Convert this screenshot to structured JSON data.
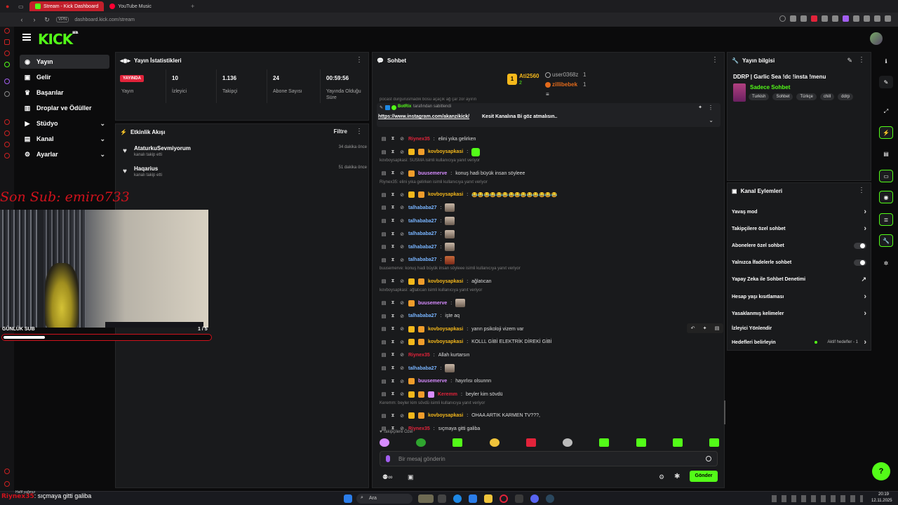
{
  "browser": {
    "tabs": [
      {
        "label": "Stream - Kick Dashboard",
        "active": true,
        "color": "#53fc18"
      },
      {
        "label": "YouTube Music",
        "active": false,
        "color": "#ff0033"
      }
    ],
    "vpn_label": "VPN",
    "url": "dashboard.kick.com/stream"
  },
  "header": {
    "logo": "KICK",
    "logo_sup": "BETA"
  },
  "sidebar": {
    "items": [
      {
        "label": "Yayın",
        "icon": "broadcast-icon",
        "active": true,
        "expandable": false
      },
      {
        "label": "Gelir",
        "icon": "wallet-icon",
        "active": false,
        "expandable": false
      },
      {
        "label": "Başarılar",
        "icon": "trophy-icon",
        "active": false,
        "expandable": false
      },
      {
        "label": "Droplar ve Ödüller",
        "icon": "gift-icon",
        "active": false,
        "expandable": false
      },
      {
        "label": "Stüdyo",
        "icon": "studio-icon",
        "active": false,
        "expandable": true
      },
      {
        "label": "Kanal",
        "icon": "channel-icon",
        "active": false,
        "expandable": true
      },
      {
        "label": "Ayarlar",
        "icon": "gear-icon",
        "active": false,
        "expandable": true
      }
    ]
  },
  "stats": {
    "title": "Yayın İstatistikleri",
    "live_badge": "YAYINDA",
    "items": [
      {
        "value": "",
        "label": "Yayın"
      },
      {
        "value": "10",
        "label": "İzleyici"
      },
      {
        "value": "1.136",
        "label": "Takipçi"
      },
      {
        "value": "24",
        "label": "Abone Sayısı"
      },
      {
        "value": "00:59:56",
        "label": "Yayında Olduğu Süre"
      }
    ]
  },
  "activity": {
    "title": "Etkinlik Akışı",
    "filter": "Filtre",
    "items": [
      {
        "name": "AtaturkuSevmiyorum",
        "sub": "kanalı takip etti",
        "time": "34 dakika önce"
      },
      {
        "name": "Haqarius",
        "sub": "kanalı takip etti",
        "time": "51 dakika önce"
      }
    ]
  },
  "overlay": {
    "last_sub": "Son Sub: emiro733",
    "daily_sub_label": "GÜNLÜK SUB",
    "daily_sub_count": "1 / 5",
    "daily_sub_progress": 0.2
  },
  "chat": {
    "title": "Sohbet",
    "top_gifters": [
      {
        "name": "Ati2560",
        "count": "2",
        "color": "#f5b81b"
      },
      {
        "name": "user0368z",
        "count": "1",
        "color": "#aaaaaa"
      },
      {
        "name": "zillibebek",
        "count": "1",
        "color": "#e36a1b"
      }
    ],
    "cut_text": "pocast durgurusmadık bosu açaçık ağ çar zor ayırın",
    "pinned": {
      "by_name": "BotRix",
      "by_suffix": "tarafından sabitlendi",
      "link": "https://www.instagram.com/akanzikick/",
      "text": " Kesit Kanalına Bi göz atmalısın.."
    },
    "messages": [
      {
        "type": "msg",
        "user": "Riynex35",
        "color": "#e2233a",
        "text": "elini yıka gelirken",
        "badges": []
      },
      {
        "type": "msg",
        "user": "kovboysapkasi",
        "color": "#f5b81b",
        "text": "",
        "badges": [
          "#f5b81b",
          "#f09d2b"
        ],
        "emote": "green"
      },
      {
        "type": "reply",
        "text": "kovboysapkasi: SUSMA isimli kullanıcıya yanıt veriyor"
      },
      {
        "type": "msg",
        "user": "buusemerve",
        "color": "#d78cff",
        "text": "konuş hadi büyük insan söyleee",
        "badges": [
          "#f09d2b"
        ]
      },
      {
        "type": "reply",
        "text": "Riynex35: elini yıka gelirken isimli kullanıcıya yanıt veriyor"
      },
      {
        "type": "msg",
        "user": "kovboysapkasi",
        "color": "#f5b81b",
        "text": "😂😂😂😂😂😂😂😂😂😂😂😂😂😂",
        "badges": [
          "#f5b81b",
          "#f09d2b"
        ]
      },
      {
        "type": "msg",
        "user": "talhababa27",
        "color": "#78b4ff",
        "text": "",
        "badges": [],
        "emote": "cat"
      },
      {
        "type": "msg",
        "user": "talhababa27",
        "color": "#78b4ff",
        "text": "",
        "badges": [],
        "emote": "cat"
      },
      {
        "type": "msg",
        "user": "talhababa27",
        "color": "#78b4ff",
        "text": "",
        "badges": [],
        "emote": "cat"
      },
      {
        "type": "msg",
        "user": "talhababa27",
        "color": "#78b4ff",
        "text": "",
        "badges": [],
        "emote": "cat"
      },
      {
        "type": "msg",
        "user": "talhababa27",
        "color": "#78b4ff",
        "text": "",
        "badges": [],
        "emote": "catred"
      },
      {
        "type": "reply",
        "text": "buusemerve: konuş hadi büyük insan söyleee isimli kullanıcıya yanıt veriyor"
      },
      {
        "type": "msg",
        "user": "kovboysapkasi",
        "color": "#f5b81b",
        "text": "ağlatıcan",
        "badges": [
          "#f5b81b",
          "#f09d2b"
        ]
      },
      {
        "type": "reply",
        "text": "kovboysapkasi: ağlatıcan isimli kullanıcıya yanıt veriyor"
      },
      {
        "type": "msg",
        "user": "buusemerve",
        "color": "#d78cff",
        "text": "",
        "badges": [
          "#f09d2b"
        ],
        "emote": "cat"
      },
      {
        "type": "msg",
        "user": "talhababa27",
        "color": "#78b4ff",
        "text": "işte aq",
        "badges": []
      },
      {
        "type": "msg",
        "user": "kovboysapkasi",
        "color": "#f5b81b",
        "text": "yarın psikoloji vizem var",
        "badges": [
          "#f5b81b",
          "#f09d2b"
        ]
      },
      {
        "type": "msg",
        "user": "kovboysapkasi",
        "color": "#f5b81b",
        "text": "KOLLL GİBİ ELEKTRİK DİREKİ GİBİ",
        "badges": [
          "#f5b81b",
          "#f09d2b"
        ]
      },
      {
        "type": "msg",
        "user": "Riynex35",
        "color": "#e2233a",
        "text": "Allah kurtarsın",
        "badges": []
      },
      {
        "type": "msg",
        "user": "talhababa27",
        "color": "#78b4ff",
        "text": "",
        "badges": [],
        "emote": "cat"
      },
      {
        "type": "msg",
        "user": "buusemerve",
        "color": "#d78cff",
        "text": "hayırlısı olsunnn",
        "badges": [
          "#f09d2b"
        ]
      },
      {
        "type": "msg",
        "user": "Keremm",
        "color": "#e2233a",
        "text": "beyler kim sövdü",
        "badges": [
          "#f5b81b",
          "#f09d2b",
          "#d78cff"
        ]
      },
      {
        "type": "reply",
        "text": "Keremm: beyler kim sövdü isimli kullanıcıya yanıt veriyor"
      },
      {
        "type": "msg",
        "user": "kovboysapkasi",
        "color": "#f5b81b",
        "text": "OHAA ARTIK KARMEN TV???,",
        "badges": [
          "#f5b81b",
          "#f09d2b"
        ]
      },
      {
        "type": "msg",
        "user": "Riynex35",
        "color": "#e2233a",
        "text": "sıçmaya gitti galiba",
        "badges": []
      }
    ],
    "followers_only": "Takipçilere Özel",
    "input_placeholder": "Bir mesaj gönderin",
    "send": "Gönder"
  },
  "stream_info": {
    "title": "Yayın bilgisi",
    "stream_title": "DDRP | Garlic Sea !dc !insta !menu",
    "category": "Sadece Sohbet",
    "tags": [
      "Turkish",
      "Sohbet",
      "Türkçe",
      "chill",
      "ddrp"
    ]
  },
  "channel_actions": {
    "title": "Kanal Eylemleri",
    "rows": [
      {
        "label": "Yavaş mod",
        "control": "chevron"
      },
      {
        "label": "Takipçilere özel sohbet",
        "control": "chevron"
      },
      {
        "label": "Abonelere özel sohbet",
        "control": "toggle"
      },
      {
        "label": "Yalnızca İfadelerle sohbet",
        "control": "toggle"
      },
      {
        "label": "Yapay Zeka ile Sohbet Denetimi",
        "control": "external"
      },
      {
        "label": "Hesap yaşı kısıtlaması",
        "control": "chevron"
      },
      {
        "label": "Yasaklanmış kelimeler",
        "control": "chevron"
      },
      {
        "label": "İzleyici Yönlendir",
        "control": "none"
      },
      {
        "label": "Hedefleri belirleyin",
        "control": "chevron",
        "extra": "Aktif hedefler - 1"
      }
    ]
  },
  "ticker": {
    "user": "Riynex35",
    "text": ": sıçmaya gitti galiba",
    "small": "Hafif yağmur"
  },
  "taskbar": {
    "search": "Ara",
    "time": "20:19",
    "date": "12.11.2025"
  },
  "colors": {
    "brand": "#53fc18",
    "live": "#e2233a",
    "overlay": "#d0121c"
  }
}
